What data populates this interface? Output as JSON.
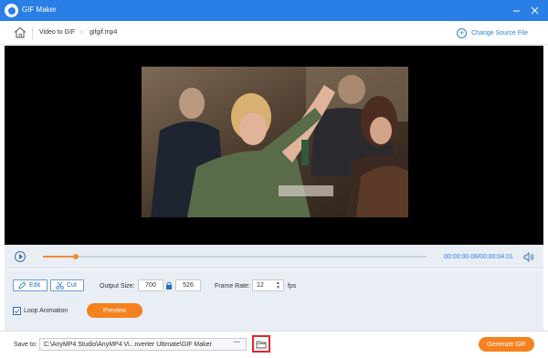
{
  "app": {
    "title": "GIF Maker"
  },
  "nav": {
    "breadcrumbs": [
      "Video to GIF",
      "gifgif.mp4"
    ],
    "change_source": "Change Source File"
  },
  "player": {
    "time": "00:00:00.08/00:00:04.01",
    "progress": 0.085
  },
  "controls": {
    "edit_label": "Edit",
    "cut_label": "Cut",
    "output_size_label": "Output Size:",
    "width": "700",
    "height": "526",
    "frame_rate_label": "Frame Rate:",
    "frame_rate": "12",
    "fps_label": "fps",
    "loop_label": "Loop Animation",
    "loop_checked": true,
    "preview_label": "Preview"
  },
  "save": {
    "label": "Save to:",
    "path": "C:\\AnyMP4 Studio\\AnyMP4 Vi...nverter Ultimate\\GIF Maker",
    "more_label": "···",
    "generate_label": "Generate GIF"
  },
  "colors": {
    "titlebar": "#2a7fe6",
    "accent": "#f5821f",
    "highlight": "#e0262a"
  }
}
